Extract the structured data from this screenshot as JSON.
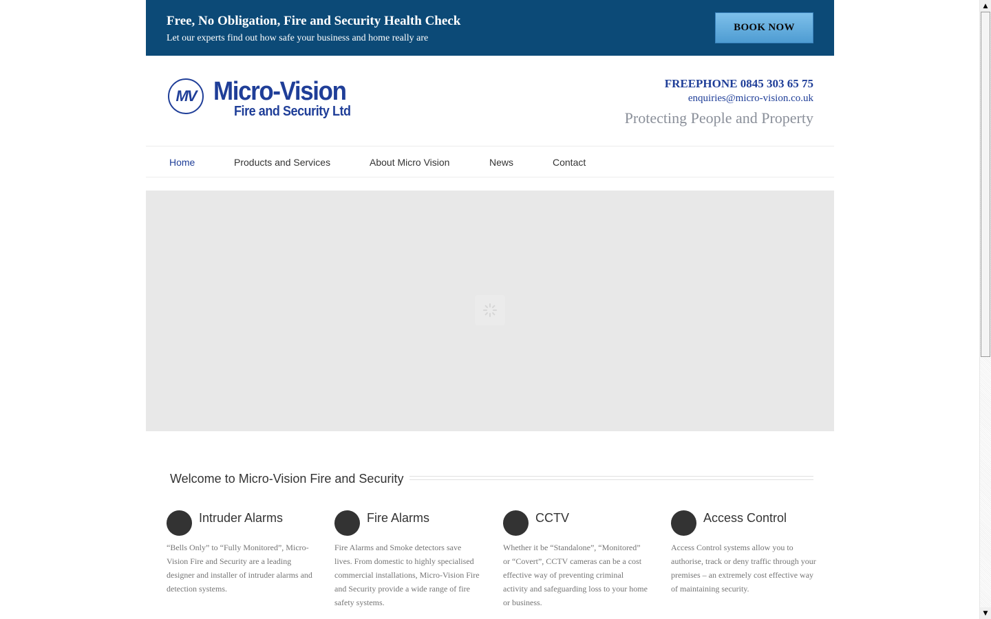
{
  "banner": {
    "title": "Free, No Obligation, Fire and Security Health Check",
    "subtitle": "Let our experts find out how safe your business and home really are",
    "book_label": "BOOK NOW"
  },
  "header": {
    "logo_mark": "MV",
    "logo_name": "Micro-Vision",
    "logo_sub": "Fire and Security Ltd",
    "phone": "FREEPHONE 0845 303 65 75",
    "email": "enquiries@micro-vision.co.uk",
    "tagline": "Protecting People and Property"
  },
  "nav": {
    "items": [
      {
        "label": "Home",
        "active": true
      },
      {
        "label": "Products and Services"
      },
      {
        "label": "About Micro Vision"
      },
      {
        "label": "News"
      },
      {
        "label": "Contact"
      }
    ]
  },
  "welcome": {
    "title": "Welcome to Micro-Vision Fire and Security"
  },
  "services": [
    {
      "title": "Intruder Alarms",
      "text": "“Bells Only” to “Fully Monitored”, Micro-Vision Fire and Security are a leading designer and installer of intruder alarms and detection systems."
    },
    {
      "title": "Fire Alarms",
      "text": "Fire Alarms and Smoke detectors save lives. From domestic to highly specialised commercial installations, Micro-Vision Fire and Security provide a wide range of fire safety systems."
    },
    {
      "title": "CCTV",
      "text": "Whether it be “Standalone”, “Monitored” or “Covert”, CCTV cameras can be a cost effective way of preventing criminal activity and safeguarding loss to your home or business."
    },
    {
      "title": "Access Control",
      "text": "Access Control systems allow you to authorise, track or deny traffic through your premises – an extremely cost effective way of maintaining security."
    }
  ],
  "colors": {
    "banner_bg": "#0c4a77",
    "brand_blue": "#1f3e98",
    "button_blue": "#5da8dd"
  },
  "icons": {
    "scroll_up": "▲",
    "scroll_down": "▼"
  }
}
